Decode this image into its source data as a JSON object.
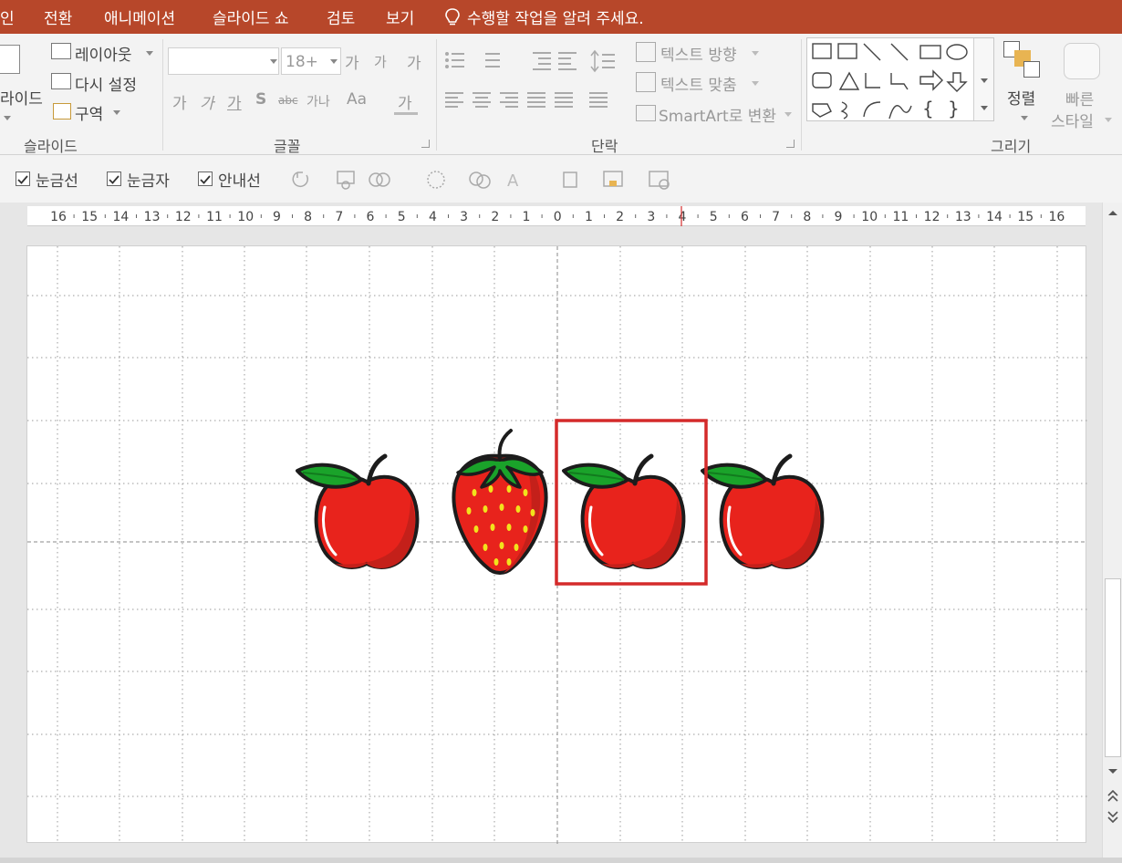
{
  "menu": {
    "tabs": [
      "인",
      "전환",
      "애니메이션",
      "슬라이드 쇼",
      "검토",
      "보기"
    ],
    "tell_me": "수행할 작업을 알려 주세요."
  },
  "ribbon": {
    "slides": {
      "new_slide_label": "라이드",
      "layout_label": "레이아웃",
      "reset_label": "다시 설정",
      "section_label": "구역",
      "group_label": "슬라이드"
    },
    "font": {
      "font_name_value": "",
      "font_size_value": "18+",
      "increase_label": "가",
      "decrease_label": "가",
      "clear_label": "가",
      "bold_label": "가",
      "italic_label": "가",
      "underline_label": "가",
      "shadow_label": "S",
      "strike_label": "abc",
      "spacing_label": "가나",
      "case_label": "Aa",
      "color_label": "가",
      "group_label": "글꼴"
    },
    "paragraph": {
      "text_direction_label": "텍스트 방향",
      "align_text_label": "텍스트 맞춤",
      "smartart_label": "SmartArt로 변환",
      "group_label": "단락"
    },
    "drawing": {
      "arrange_label": "정렬",
      "quick_styles_label": "빠른",
      "quick_styles_label2": "스타일",
      "group_label": "그리기"
    }
  },
  "toolbar2": {
    "gridlines_label": "눈금선",
    "ruler_label": "눈금자",
    "guides_label": "안내선",
    "gridlines_checked": true,
    "ruler_checked": true,
    "guides_checked": true
  },
  "ruler": {
    "labels": [
      "16",
      "15",
      "14",
      "13",
      "12",
      "11",
      "10",
      "9",
      "8",
      "7",
      "6",
      "5",
      "4",
      "3",
      "2",
      "1",
      "0",
      "1",
      "2",
      "3",
      "4",
      "5",
      "6",
      "7",
      "8",
      "9",
      "10",
      "11",
      "12",
      "13",
      "14",
      "15",
      "16"
    ]
  },
  "slide": {
    "objects": [
      {
        "kind": "apple",
        "name": "apple-1"
      },
      {
        "kind": "strawberry",
        "name": "strawberry"
      },
      {
        "kind": "apple",
        "name": "apple-2",
        "selected": true
      },
      {
        "kind": "apple",
        "name": "apple-3"
      }
    ],
    "colors": {
      "fruit": "#e8231c",
      "shade": "#c4201a",
      "leaf": "#1aa32a",
      "outline": "#1c1c1c",
      "seed": "#f2e21c",
      "selection": "#d42a2a"
    }
  },
  "colors": {
    "accent": "#b7472a"
  }
}
